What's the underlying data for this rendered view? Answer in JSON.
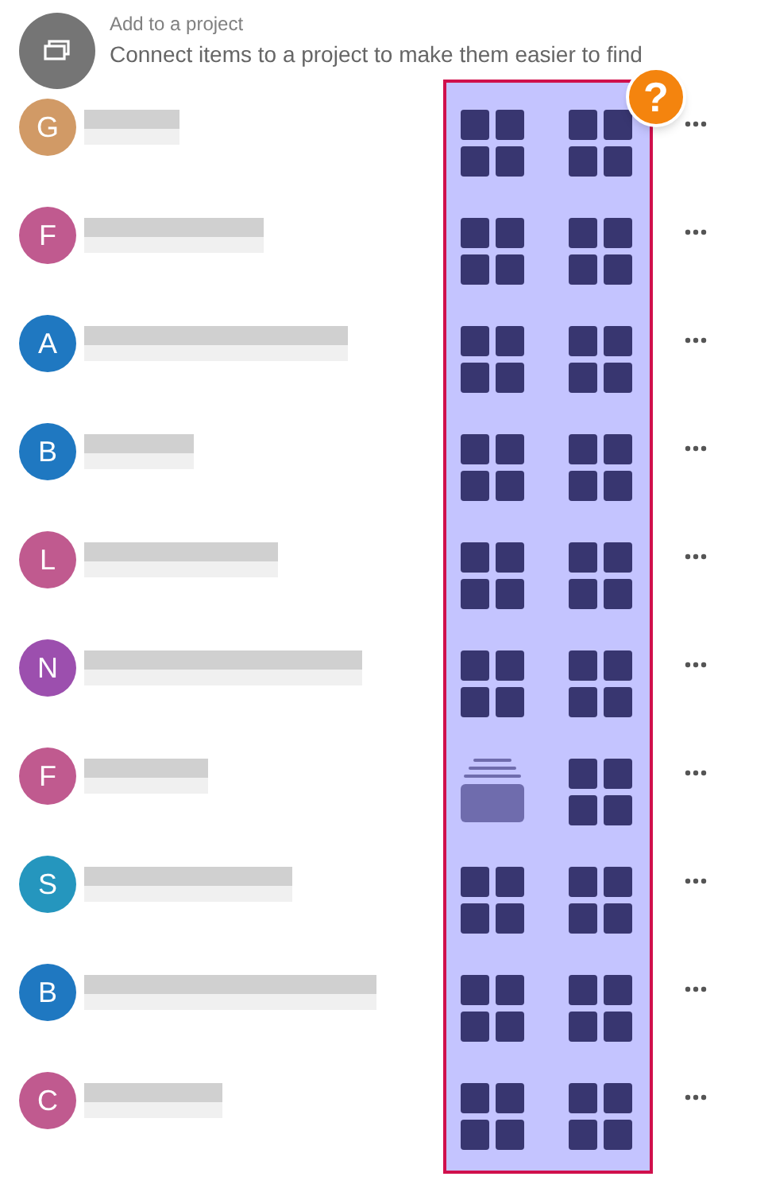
{
  "header": {
    "title": "Add to a project",
    "subtitle": "Connect items to a project to make them easier to find"
  },
  "help_badge": "?",
  "rows": [
    {
      "initial": "G",
      "color": "#d19a66",
      "cells": [
        {
          "kind": "grid"
        },
        {
          "kind": "grid"
        }
      ]
    },
    {
      "initial": "F",
      "color": "#c05a8f",
      "cells": [
        {
          "kind": "grid"
        },
        {
          "kind": "grid"
        }
      ]
    },
    {
      "initial": "A",
      "color": "#1f78c1",
      "cells": [
        {
          "kind": "grid"
        },
        {
          "kind": "grid"
        }
      ]
    },
    {
      "initial": "B",
      "color": "#1f78c1",
      "cells": [
        {
          "kind": "grid"
        },
        {
          "kind": "grid"
        }
      ]
    },
    {
      "initial": "L",
      "color": "#c05a8f",
      "cells": [
        {
          "kind": "grid"
        },
        {
          "kind": "grid"
        }
      ]
    },
    {
      "initial": "N",
      "color": "#9c4fae",
      "cells": [
        {
          "kind": "grid"
        },
        {
          "kind": "grid"
        }
      ]
    },
    {
      "initial": "F",
      "color": "#c05a8f",
      "cells": [
        {
          "kind": "stack"
        },
        {
          "kind": "grid"
        }
      ]
    },
    {
      "initial": "S",
      "color": "#2596be",
      "cells": [
        {
          "kind": "grid"
        },
        {
          "kind": "grid"
        }
      ]
    },
    {
      "initial": "B",
      "color": "#1f78c1",
      "cells": [
        {
          "kind": "grid"
        },
        {
          "kind": "grid"
        }
      ]
    },
    {
      "initial": "C",
      "color": "#c05a8f",
      "cells": [
        {
          "kind": "grid"
        },
        {
          "kind": "grid"
        }
      ]
    }
  ]
}
